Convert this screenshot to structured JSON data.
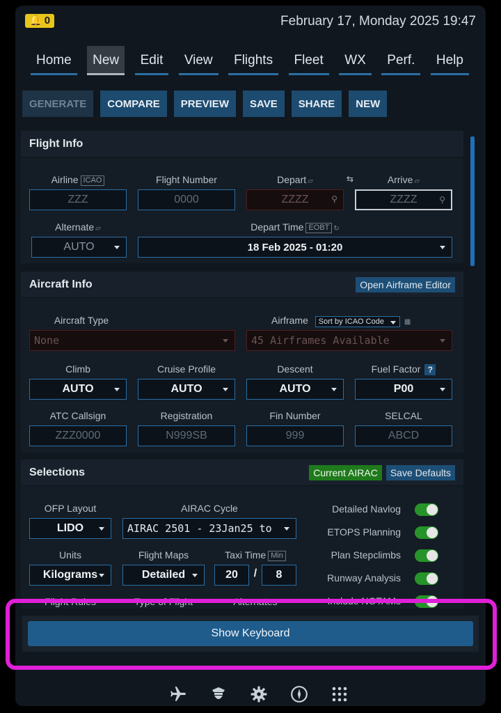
{
  "status": {
    "notification_count": "0",
    "datetime": "February 17, Monday 2025 19:47"
  },
  "menu": [
    {
      "label": "Home"
    },
    {
      "label": "New"
    },
    {
      "label": "Edit"
    },
    {
      "label": "View"
    },
    {
      "label": "Flights"
    },
    {
      "label": "Fleet"
    },
    {
      "label": "WX"
    },
    {
      "label": "Perf."
    },
    {
      "label": "Help"
    }
  ],
  "active_menu": "New",
  "actions": {
    "generate": "GENERATE",
    "compare": "COMPARE",
    "preview": "PREVIEW",
    "save": "SAVE",
    "share": "SHARE",
    "new": "NEW"
  },
  "flight_info": {
    "title": "Flight Info",
    "airline_label": "Airline",
    "icao_tag": "ICAO",
    "airline_placeholder": "ZZZ",
    "flight_number_label": "Flight Number",
    "flight_number_placeholder": "0000",
    "depart_label": "Depart",
    "depart_placeholder": "ZZZZ",
    "arrive_label": "Arrive",
    "arrive_placeholder": "ZZZZ",
    "alternate_label": "Alternate",
    "alternate_value": "AUTO",
    "depart_time_label": "Depart Time",
    "eobt_tag": "EOBT",
    "depart_time_value": "18 Feb 2025 - 01:20"
  },
  "aircraft_info": {
    "title": "Aircraft Info",
    "editor_button": "Open Airframe Editor",
    "aircraft_type_label": "Aircraft Type",
    "aircraft_type_value": "None",
    "airframe_label": "Airframe",
    "airframe_sort": "Sort by ICAO Code",
    "airframe_value": "45 Airframes Available",
    "climb_label": "Climb",
    "climb_value": "AUTO",
    "cruise_label": "Cruise Profile",
    "cruise_value": "AUTO",
    "descent_label": "Descent",
    "descent_value": "AUTO",
    "fuel_factor_label": "Fuel Factor",
    "fuel_factor_help": "?",
    "fuel_factor_value": "P00",
    "callsign_label": "ATC Callsign",
    "callsign_placeholder": "ZZZ0000",
    "registration_label": "Registration",
    "registration_placeholder": "N999SB",
    "fin_label": "Fin Number",
    "fin_placeholder": "999",
    "selcal_label": "SELCAL",
    "selcal_placeholder": "ABCD"
  },
  "selections": {
    "title": "Selections",
    "current_airac_button": "Current AIRAC",
    "save_defaults_button": "Save Defaults",
    "ofp_layout_label": "OFP Layout",
    "ofp_layout_value": "LIDO",
    "airac_label": "AIRAC Cycle",
    "airac_value": "AIRAC 2501 - 23Jan25 to",
    "units_label": "Units",
    "units_value": "Kilograms",
    "flight_maps_label": "Flight Maps",
    "flight_maps_value": "Detailed",
    "taxi_time_label": "Taxi Time",
    "min_tag": "Min",
    "taxi_out": "20",
    "taxi_sep": "/",
    "taxi_in": "8",
    "flight_rules_label": "Flight Rules",
    "type_of_flight_label": "Type of Flight",
    "alternates_label": "Alternates",
    "toggles": [
      {
        "label": "Detailed Navlog",
        "on": true
      },
      {
        "label": "ETOPS Planning",
        "on": true
      },
      {
        "label": "Plan Stepclimbs",
        "on": true
      },
      {
        "label": "Runway Analysis",
        "on": true
      },
      {
        "label": "Include NOTAMs",
        "on": true
      }
    ]
  },
  "keyboard_button": "Show Keyboard",
  "bottom_nav": [
    {
      "icon": "airplane-icon"
    },
    {
      "icon": "pilot-icon"
    },
    {
      "icon": "gear-icon"
    },
    {
      "icon": "compass-icon"
    },
    {
      "icon": "grid-icon"
    }
  ],
  "colors": {
    "accent": "#1f5c8c",
    "toggle_on": "#27942a",
    "highlight": "#e020d8",
    "badge": "#e8c51a"
  }
}
